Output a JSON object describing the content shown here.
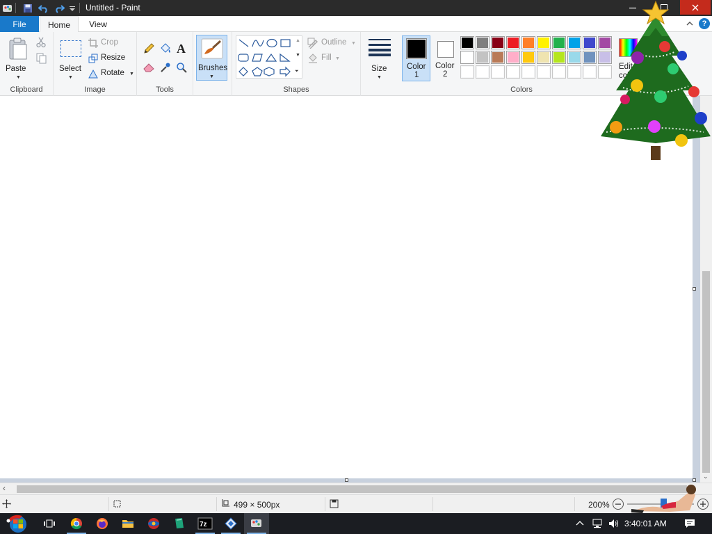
{
  "window": {
    "title": "Untitled - Paint"
  },
  "tabs": {
    "file": "File",
    "home": "Home",
    "view": "View"
  },
  "clipboard": {
    "group_label": "Clipboard",
    "paste": "Paste"
  },
  "image": {
    "group_label": "Image",
    "select": "Select",
    "crop": "Crop",
    "resize": "Resize",
    "rotate": "Rotate"
  },
  "tools": {
    "group_label": "Tools"
  },
  "brushes": {
    "label": "Brushes"
  },
  "shapes": {
    "group_label": "Shapes",
    "outline": "Outline",
    "fill": "Fill"
  },
  "size": {
    "label": "Size"
  },
  "color1": {
    "label": "Color",
    "number": "1",
    "value": "#000000"
  },
  "color2": {
    "label": "Color",
    "number": "2",
    "value": "#ffffff"
  },
  "colors": {
    "group_label": "Colors",
    "edit_colors_label": "Edit colors",
    "row1": [
      "#000000",
      "#7f7f7f",
      "#880015",
      "#ed1c24",
      "#ff7f27",
      "#fff200",
      "#22b14c",
      "#00a2e8",
      "#3f48cc",
      "#a349a4"
    ],
    "row2": [
      "#ffffff",
      "#c3c3c3",
      "#b97a57",
      "#ffaec9",
      "#ffc90e",
      "#efe4b0",
      "#b5e61d",
      "#99d9ea",
      "#7092be",
      "#c8bfe7"
    ],
    "row3_count": 10
  },
  "status": {
    "image_size": "499 × 500px",
    "zoom": "200%"
  },
  "taskbar": {
    "time": "3:40:01 AM"
  }
}
